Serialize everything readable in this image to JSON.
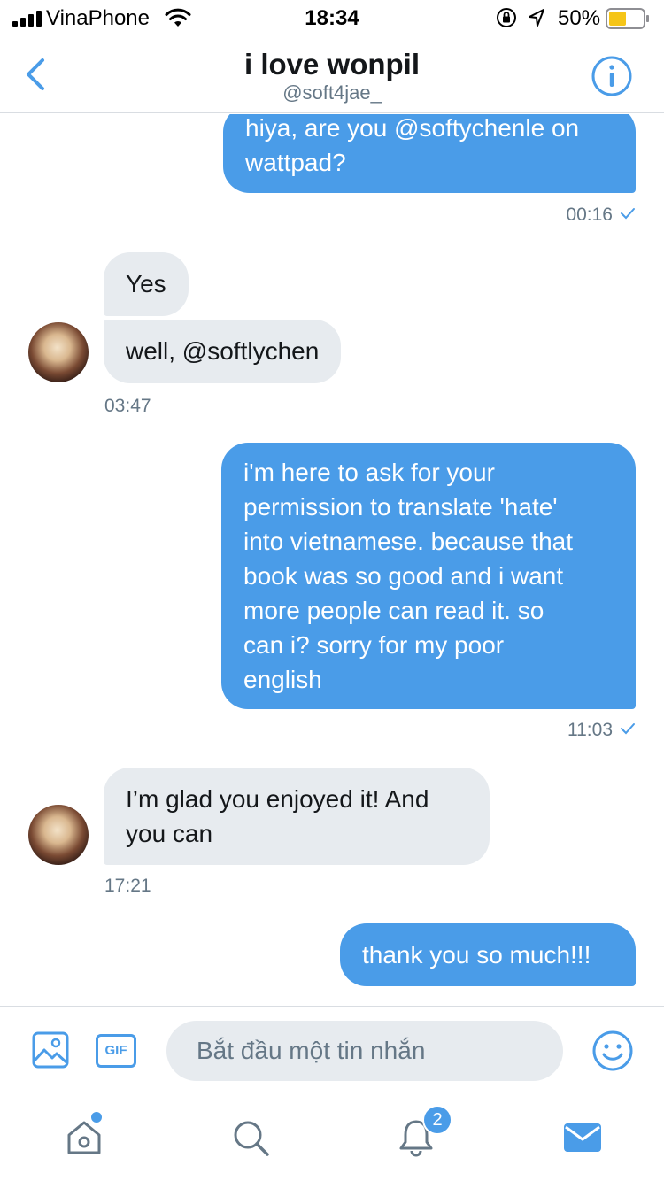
{
  "status_bar": {
    "carrier": "VinaPhone",
    "time": "18:34",
    "battery_percent": "50%"
  },
  "header": {
    "title": "i love wonpil",
    "handle": "@soft4jae_"
  },
  "conversation": {
    "messages": [
      {
        "direction": "sent",
        "lines": [
          "hiya, are you @softychenle on",
          "wattpad?"
        ],
        "time": "00:16"
      },
      {
        "direction": "received",
        "lines": [
          "Yes"
        ]
      },
      {
        "direction": "received",
        "lines": [
          "well, @softlychen"
        ],
        "time": "03:47"
      },
      {
        "direction": "sent",
        "lines": [
          "i'm here to ask for your",
          "permission to translate 'hate'",
          "into vietnamese. because that",
          "book was so good and i want",
          "more people can read it. so",
          "can i? sorry for my poor",
          "english"
        ],
        "time": "11:03"
      },
      {
        "direction": "received",
        "lines": [
          "I’m glad you enjoyed it! And",
          "you can"
        ],
        "time": "17:21"
      },
      {
        "direction": "sent",
        "lines": [
          "thank you so much!!!"
        ]
      }
    ]
  },
  "composer": {
    "placeholder": "Bắt đầu một tin nhắn",
    "gif_label": "GIF"
  },
  "tabbar": {
    "notifications_badge": "2"
  },
  "colors": {
    "accent": "#4a9ce8",
    "received_bubble": "#e7ebef",
    "secondary_text": "#657786"
  }
}
